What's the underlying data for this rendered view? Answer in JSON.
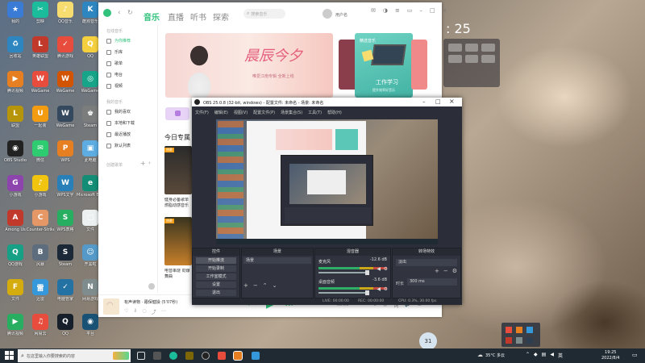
{
  "desktop": {
    "icons": [
      {
        "label": "我的",
        "color": "#3a7bd5",
        "col": 0,
        "row": 0,
        "glyph": "★"
      },
      {
        "label": "回收站",
        "color": "#2e86c1",
        "col": 0,
        "row": 1,
        "glyph": "♻"
      },
      {
        "label": "腾讯视频",
        "color": "#e67e22",
        "col": 0,
        "row": 2,
        "glyph": "▶"
      },
      {
        "label": "联盟",
        "color": "#b7950b",
        "col": 0,
        "row": 3,
        "glyph": "L"
      },
      {
        "label": "OBS Studio",
        "color": "#222222",
        "col": 0,
        "row": 4,
        "glyph": "◉"
      },
      {
        "label": "小游戏",
        "color": "#8e44ad",
        "col": 0,
        "row": 5,
        "glyph": "G"
      },
      {
        "label": "Among Us",
        "color": "#c0392b",
        "col": 0,
        "row": 6,
        "glyph": "A"
      },
      {
        "label": "QQ游戏",
        "color": "#16a085",
        "col": 0,
        "row": 7,
        "glyph": "Q"
      },
      {
        "label": "文件",
        "color": "#d4ac0d",
        "col": 0,
        "row": 8,
        "glyph": "F"
      },
      {
        "label": "腾讯视频",
        "color": "#27ae60",
        "col": 0,
        "row": 9,
        "glyph": "▶"
      },
      {
        "label": "剪映",
        "color": "#1abc9c",
        "col": 1,
        "row": 0,
        "glyph": "✂"
      },
      {
        "label": "英雄联盟",
        "color": "#c0392b",
        "col": 1,
        "row": 1,
        "glyph": "L"
      },
      {
        "label": "WeGame",
        "color": "#e74c3c",
        "col": 1,
        "row": 2,
        "glyph": "W"
      },
      {
        "label": "一起装",
        "color": "#f39c12",
        "col": 1,
        "row": 3,
        "glyph": "U"
      },
      {
        "label": "微信",
        "color": "#2ecc71",
        "col": 1,
        "row": 4,
        "glyph": "✉"
      },
      {
        "label": "小游戏",
        "color": "#f1c40f",
        "col": 1,
        "row": 5,
        "glyph": "♪"
      },
      {
        "label": "Counter-Strike Global",
        "color": "#e59866",
        "col": 1,
        "row": 6,
        "glyph": "C"
      },
      {
        "label": "风暴",
        "color": "#5d6d7e",
        "col": 1,
        "row": 7,
        "glyph": "B"
      },
      {
        "label": "迅雷",
        "color": "#3498db",
        "col": 1,
        "row": 8,
        "glyph": "雷"
      },
      {
        "label": "网易云",
        "color": "#e74c3c",
        "col": 1,
        "row": 9,
        "glyph": "♫"
      },
      {
        "label": "QQ音乐",
        "color": "#f7dc6f",
        "col": 2,
        "row": 0,
        "glyph": "♪"
      },
      {
        "label": "腾讯游戏",
        "color": "#e74c3c",
        "col": 2,
        "row": 1,
        "glyph": "✓"
      },
      {
        "label": "WeGame",
        "color": "#d35400",
        "col": 2,
        "row": 2,
        "glyph": "W"
      },
      {
        "label": "WeGame",
        "color": "#34495e",
        "col": 2,
        "row": 3,
        "glyph": "W"
      },
      {
        "label": "WPS",
        "color": "#e67e22",
        "col": 2,
        "row": 4,
        "glyph": "P"
      },
      {
        "label": "WPS文字",
        "color": "#2980b9",
        "col": 2,
        "row": 5,
        "glyph": "W"
      },
      {
        "label": "WPS表格",
        "color": "#27ae60",
        "col": 2,
        "row": 6,
        "glyph": "S"
      },
      {
        "label": "Steam",
        "color": "#1b2838",
        "col": 2,
        "row": 7,
        "glyph": "S"
      },
      {
        "label": "电脑管家",
        "color": "#2471a3",
        "col": 2,
        "row": 8,
        "glyph": "✓"
      },
      {
        "label": "QQ",
        "color": "#17202a",
        "col": 2,
        "row": 9,
        "glyph": "Q"
      },
      {
        "label": "酷狗音乐",
        "color": "#2e86c1",
        "col": 3,
        "row": 0,
        "glyph": "K"
      },
      {
        "label": "QQ",
        "color": "#f4d03f",
        "col": 3,
        "row": 1,
        "glyph": "Q"
      },
      {
        "label": "WeGame",
        "color": "#17a589",
        "col": 3,
        "row": 2,
        "glyph": "◎"
      },
      {
        "label": "Steam",
        "color": "#7b7d7d",
        "col": 3,
        "row": 3,
        "glyph": "♚"
      },
      {
        "label": "此电脑",
        "color": "#5dade2",
        "col": 3,
        "row": 4,
        "glyph": "▣"
      },
      {
        "label": "Microsoft Edge",
        "color": "#138d75",
        "col": 3,
        "row": 5,
        "glyph": "e"
      },
      {
        "label": "文件",
        "color": "#ecf0f1",
        "col": 3,
        "row": 6,
        "glyph": "▢"
      },
      {
        "label": "开黑啦",
        "color": "#5499c7",
        "col": 3,
        "row": 7,
        "glyph": "☺"
      },
      {
        "label": "网易游戏",
        "color": "#7f8c8d",
        "col": 3,
        "row": 8,
        "glyph": "N"
      },
      {
        "label": "平台",
        "color": "#1a5276",
        "col": 3,
        "row": 9,
        "glyph": "◉"
      }
    ]
  },
  "music": {
    "tabs": [
      "音乐",
      "直播",
      "听书",
      "探索"
    ],
    "search_placeholder": "搜索音乐",
    "username": "用户名",
    "sidebar": {
      "section_online": "在线音乐",
      "items": [
        "为你推荐",
        "乐库",
        "歌单",
        "电台",
        "视频"
      ],
      "section_mine": "我的音乐",
      "mine_items": [
        "我的喜欢",
        "本地和下载",
        "最近播放",
        "默认列表"
      ],
      "section_playlist": "创建歌单"
    },
    "banner_title": "晨辰今夕",
    "banner_sub": "唯爱江南专辑 全新上线",
    "side_banner_tag": "精选音乐",
    "side_banner_title": "工作学习",
    "side_banner_sub": "提升效率好音乐",
    "section_today": "今日专属",
    "card1_tag": "热歌",
    "card1_text": "健身必备歌单 燃脂动感音乐",
    "card2_tag": "热歌",
    "card2_text": "电音串烧 劲爆舞曲",
    "now_playing": "有声读物 · 跟保健操 (5'07秒)",
    "bar_time": "00:00"
  },
  "obs": {
    "title": "OBS 25.0.8 (32-bit, windows) - 配置文件: 未命名 - 场景: 未命名",
    "menu": [
      "文件(F)",
      "编辑(E)",
      "视图(V)",
      "配置文件(P)",
      "场景集合(S)",
      "工具(T)",
      "帮助(H)"
    ],
    "docks": {
      "controls": "控件",
      "scenes": "场景",
      "mixer": "混音器",
      "sources": "来源",
      "transitions": "转场特效"
    },
    "control_buttons": [
      "开始推流",
      "开始录制",
      "工作室模式",
      "设置",
      "退出"
    ],
    "scene_name": "场景",
    "mixer_tracks": [
      {
        "name": "麦克风",
        "db": "-12.6 dB"
      },
      {
        "name": "桌面音频",
        "db": "-3.6 dB"
      }
    ],
    "transition_label": "淡出",
    "duration_label": "时长",
    "duration_value": "300 ms",
    "status": {
      "live": "LIVE: 00:00:00",
      "rec": "REC: 00:00:00",
      "cpu": "CPU: 0.3%, 30.00 fps"
    }
  },
  "clock_widget": {
    "time": "25"
  },
  "weather": {
    "percent": "31",
    "temp": "35°C 多云"
  },
  "taskbar": {
    "search_placeholder": "在这里输入你要搜索的内容",
    "time": "19:25",
    "date": "2022/8/4",
    "lang": "英"
  }
}
